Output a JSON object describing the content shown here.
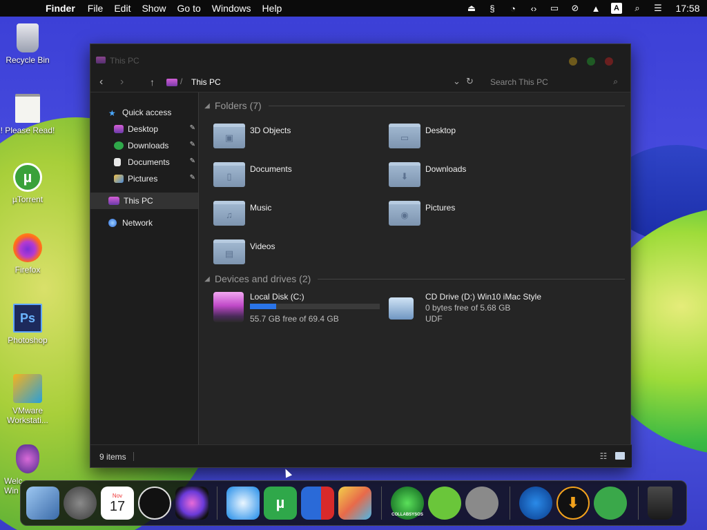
{
  "menubar": {
    "app_name": "Finder",
    "items": [
      "File",
      "Edit",
      "Show",
      "Go to",
      "Windows",
      "Help"
    ],
    "clock": "17:58",
    "status_icons": [
      "eject-icon",
      "script-icon",
      "pie-icon",
      "code-icon",
      "monitor-icon",
      "mute-icon",
      "upload-icon",
      "input-icon",
      "search-icon",
      "control-center-icon"
    ]
  },
  "desktop": {
    "icons": [
      {
        "label": "Recycle Bin"
      },
      {
        "label": "! Please Read!"
      },
      {
        "label": "µTorrent"
      },
      {
        "label": "Firefox"
      },
      {
        "label": "Photoshop"
      },
      {
        "label": "VMware Workstati..."
      },
      {
        "label": "Welc Win"
      }
    ]
  },
  "window": {
    "title": "This PC",
    "breadcrumb": "This PC",
    "search_placeholder": "Search This PC",
    "sidebar": {
      "quick_access": "Quick access",
      "pinned": [
        "Desktop",
        "Downloads",
        "Documents",
        "Pictures"
      ],
      "this_pc": "This PC",
      "network": "Network"
    },
    "folders_header": "Folders (7)",
    "folders": [
      "3D Objects",
      "Desktop",
      "Documents",
      "Downloads",
      "Music",
      "Pictures",
      "Videos"
    ],
    "devices_header": "Devices and drives (2)",
    "drives": [
      {
        "name": "Local Disk (C:)",
        "free": "55.7 GB free of 69.4 GB",
        "used_fraction": 0.2
      },
      {
        "name": "CD Drive (D:) Win10 iMac Style",
        "free": "0 bytes free of 5.68 GB",
        "fs": "UDF"
      }
    ],
    "status": "9 items"
  },
  "dock": {
    "calendar_month": "Nov",
    "calendar_day": "17",
    "collabsysos": "COLLABSYSOS"
  },
  "colors": {
    "accent": "#2a74e8",
    "traffic_yellow": "#6e5a1c",
    "traffic_green": "#1f5a24",
    "traffic_red": "#6a1f1f"
  }
}
